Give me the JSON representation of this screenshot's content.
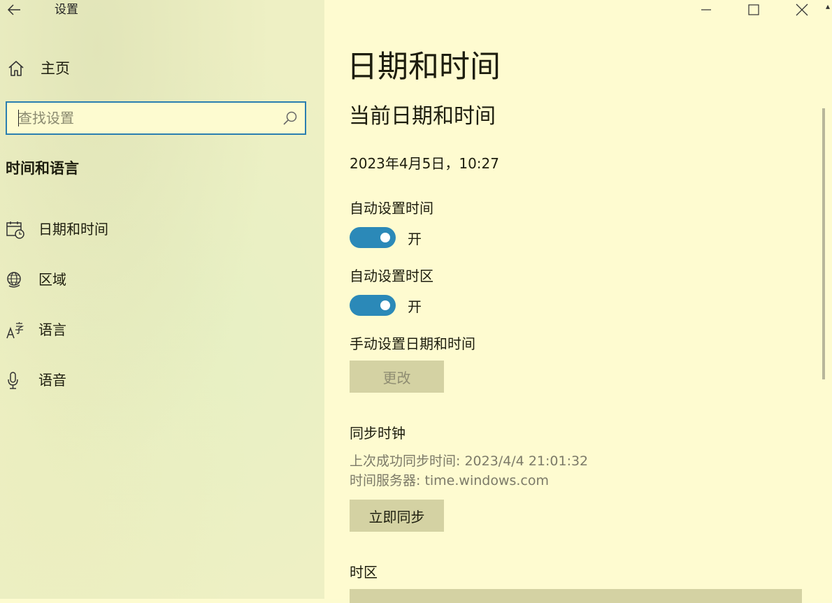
{
  "window": {
    "title": "设置",
    "controls": {
      "minimize_icon": "minimize-icon",
      "maximize_icon": "maximize-icon",
      "close_icon": "close-icon"
    }
  },
  "sidebar": {
    "home_label": "主页",
    "search": {
      "placeholder": "查找设置",
      "value": ""
    },
    "section_title": "时间和语言",
    "items": [
      {
        "label": "日期和时间",
        "icon": "calendar-clock-icon"
      },
      {
        "label": "区域",
        "icon": "globe-icon"
      },
      {
        "label": "语言",
        "icon": "language-icon"
      },
      {
        "label": "语音",
        "icon": "microphone-icon"
      }
    ]
  },
  "main": {
    "page_title": "日期和时间",
    "current_section_title": "当前日期和时间",
    "current_datetime": "2023年4月5日，10:27",
    "auto_time": {
      "label": "自动设置时间",
      "state": "开"
    },
    "auto_timezone": {
      "label": "自动设置时区",
      "state": "开"
    },
    "manual": {
      "label": "手动设置日期和时间",
      "button": "更改"
    },
    "sync": {
      "title": "同步时钟",
      "last_sync": "上次成功同步时间: 2023/4/4 21:01:32",
      "server": "时间服务器: time.windows.com",
      "button": "立即同步"
    },
    "timezone": {
      "label": "时区"
    }
  },
  "colors": {
    "accent": "#2b7fb0",
    "toggle_on": "#2b89b8",
    "sidebar_bg": "#eef0c4",
    "main_bg": "#fefbd0",
    "button_bg": "#d4d2a3"
  }
}
